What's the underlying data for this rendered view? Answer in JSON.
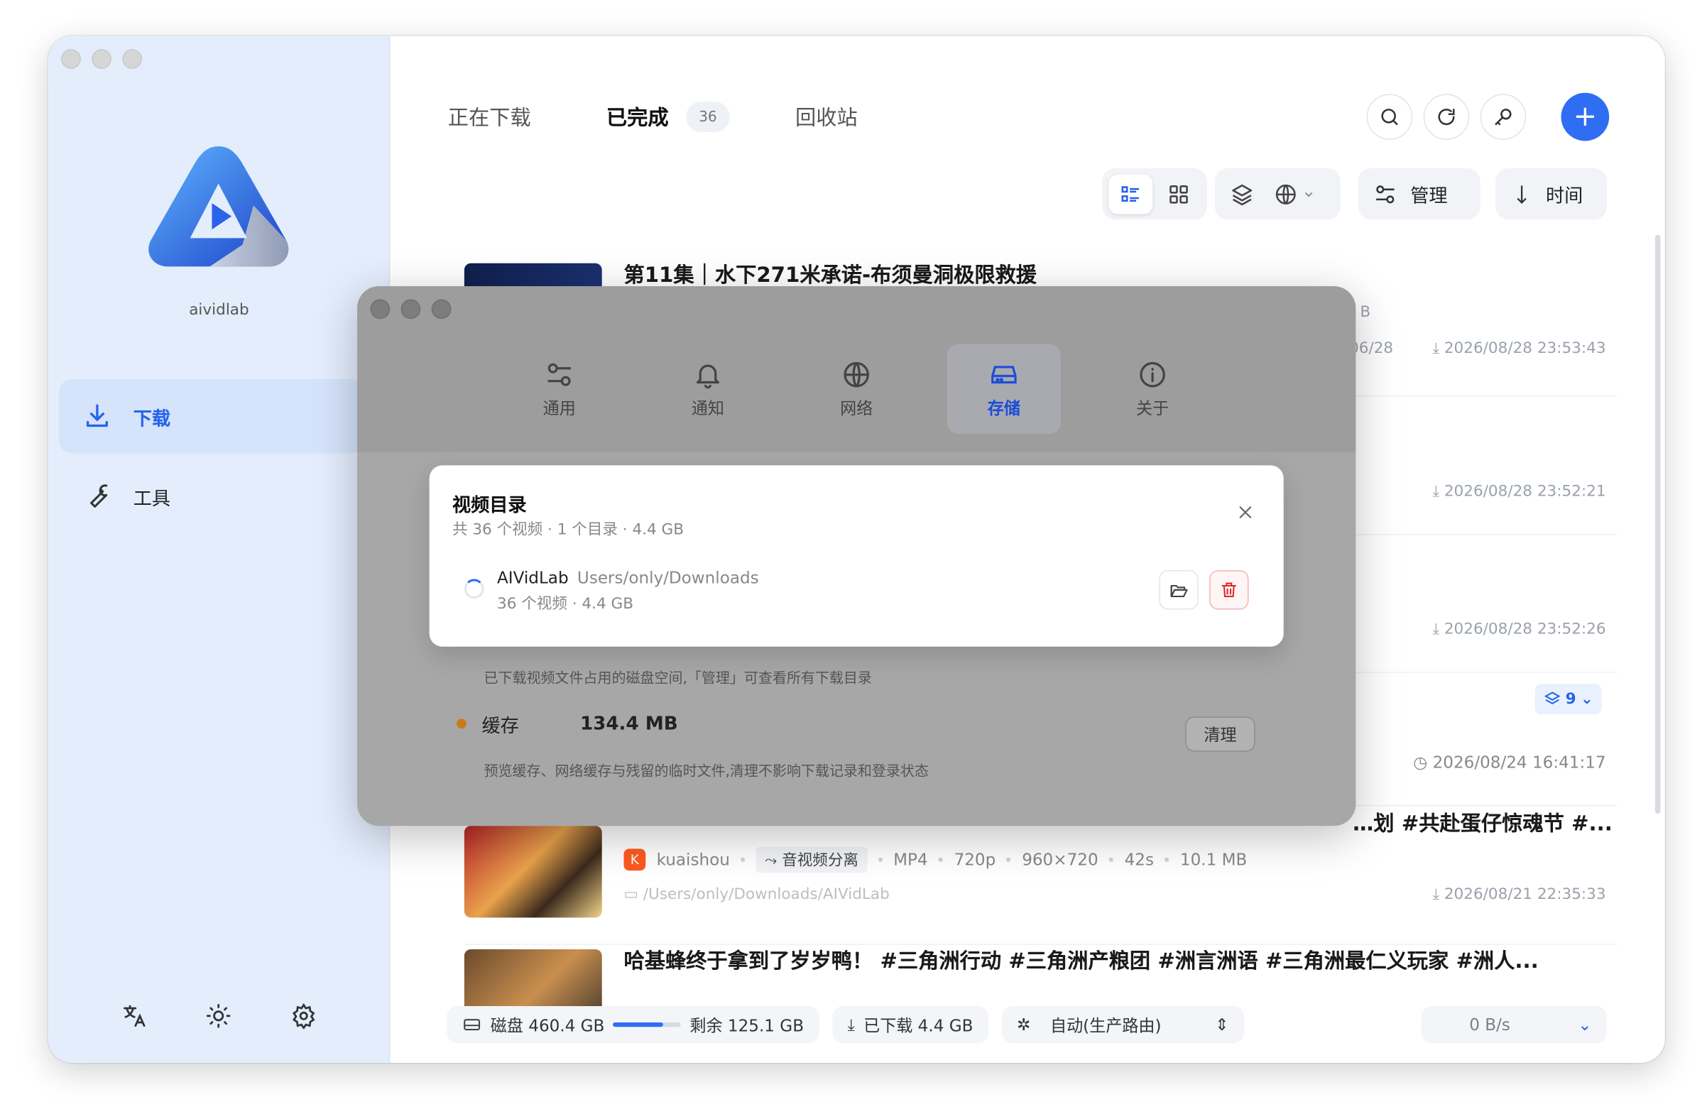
{
  "app": {
    "name": "aividlab"
  },
  "sidebar": {
    "items": [
      {
        "label": "下载",
        "icon": "download-icon",
        "active": true
      },
      {
        "label": "工具",
        "icon": "wrench-icon",
        "active": false
      }
    ],
    "bottom_icons": [
      "translate-icon",
      "sun-icon",
      "settings-icon"
    ]
  },
  "tabs": [
    {
      "label": "正在下载"
    },
    {
      "label": "已完成",
      "count": "36"
    },
    {
      "label": "回收站"
    }
  ],
  "toolbar": {
    "manage_label": "管理",
    "sort_label": "时间"
  },
  "items": [
    {
      "title": "第11集｜水下271米承诺-布须曼洞极限救援",
      "date": "2026/08/28 23:53:43",
      "partial_date": "06/28",
      "partial_size": "B"
    },
    {
      "title": "",
      "date": "2026/08/28 23:52:21"
    },
    {
      "title": "",
      "date": "2026/08/28 23:52:26"
    },
    {
      "title": "",
      "date": "2026/08/24 16:41:17",
      "stack_count": "9"
    },
    {
      "title": "…划 #共赴蛋仔惊魂节 #...",
      "source": "kuaishou",
      "tag": "音视频分离",
      "format": "MP4",
      "quality": "720p",
      "resolution": "960×720",
      "duration": "42s",
      "size": "10.1 MB",
      "path": "/Users/only/Downloads/AIVidLab",
      "date": "2026/08/21 22:35:33"
    },
    {
      "title": "哈基蜂终于拿到了岁岁鸭！ #三角洲行动 #三角洲产粮团 #洲言洲语 #三角洲最仁义玩家 #洲人..."
    }
  ],
  "statusbar": {
    "disk_label": "磁盘 460.4 GB",
    "disk_used_fraction": 0.73,
    "remaining_label": "剩余 125.1 GB",
    "downloaded_label": "已下载 4.4 GB",
    "route_label": "自动(生产路由)",
    "speed_label": "0 B/s"
  },
  "settings": {
    "tabs": [
      {
        "label": "通用",
        "icon": "sliders-icon"
      },
      {
        "label": "通知",
        "icon": "bell-icon"
      },
      {
        "label": "网络",
        "icon": "globe-icon"
      },
      {
        "label": "存储",
        "icon": "drive-icon",
        "active": true
      },
      {
        "label": "关于",
        "icon": "info-icon"
      }
    ],
    "disk_desc": "已下载视频文件占用的磁盘空间,「管理」可查看所有下载目录",
    "cache_label": "缓存",
    "cache_size": "134.4 MB",
    "cache_desc": "预览缓存、网络缓存与残留的临时文件,清理不影响下载记录和登录状态",
    "clear_label": "清理"
  },
  "dialog": {
    "title": "视频目录",
    "subtitle": "共 36 个视频 · 1 个目录 · 4.4 GB",
    "dir_name": "AIVidLab",
    "dir_path": "Users/only/Downloads",
    "dir_info": "36 个视频 · 4.4 GB"
  },
  "colors": {
    "accent": "#2f6ef3",
    "danger": "#dc2626",
    "cache_dot": "#c97a16"
  }
}
